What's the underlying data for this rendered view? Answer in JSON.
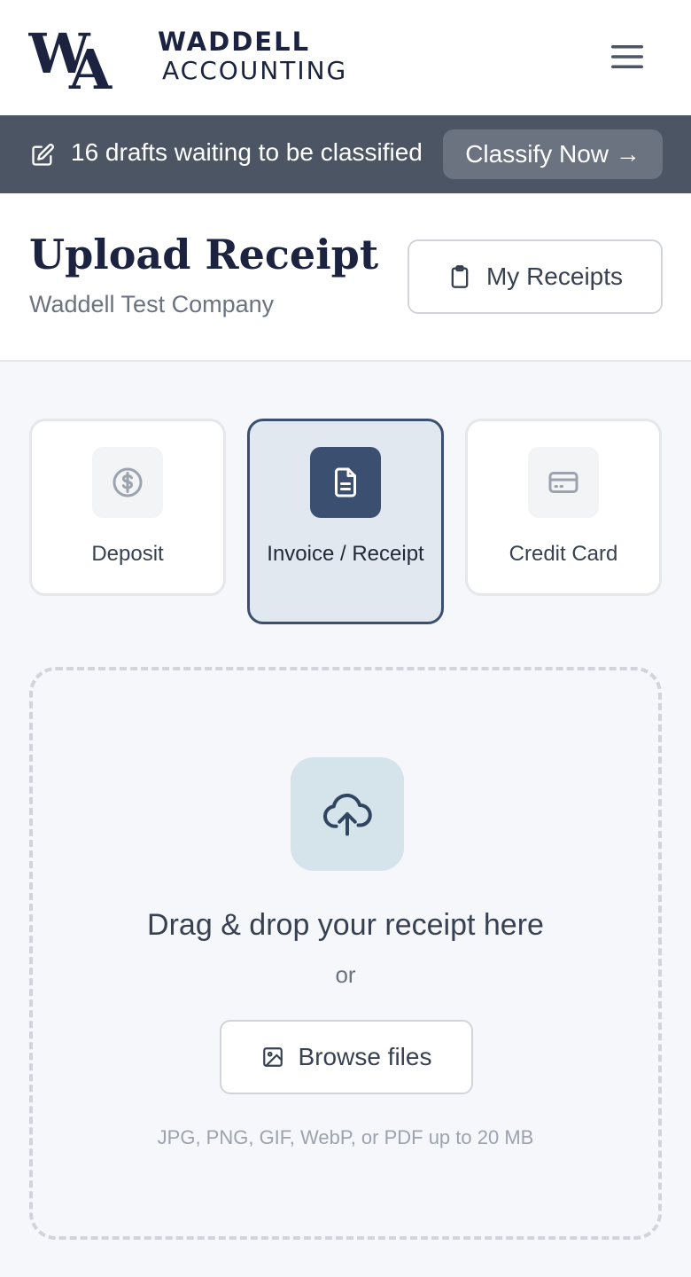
{
  "brand": {
    "line1": "WADDELL",
    "line2": "ACCOUNTING",
    "logo_icon": "wa-monogram-icon",
    "menu_icon": "hamburger-menu-icon"
  },
  "banner": {
    "icon": "edit-icon",
    "message": "16 drafts waiting to be classified",
    "action_label": "Classify Now →"
  },
  "page": {
    "title": "Upload Receipt",
    "company": "Waddell Test Company",
    "my_receipts_label": "My Receipts",
    "my_receipts_icon": "clipboard-icon"
  },
  "types": [
    {
      "label": "Deposit",
      "icon": "dollar-circle-icon",
      "selected": false
    },
    {
      "label": "Invoice / Receipt",
      "icon": "document-icon",
      "selected": true
    },
    {
      "label": "Credit Card",
      "icon": "credit-card-icon",
      "selected": false
    }
  ],
  "dropzone": {
    "icon": "cloud-upload-icon",
    "title": "Drag & drop your receipt here",
    "or": "or",
    "browse_label": "Browse files",
    "browse_icon": "image-icon",
    "hint": "JPG, PNG, GIF, WebP, or PDF up to 20 MB"
  },
  "colors": {
    "brand_navy": "#1b2340",
    "banner_bg": "#4b5563",
    "selected_accent": "#3b5070",
    "upload_tint": "#d5e3ea"
  }
}
